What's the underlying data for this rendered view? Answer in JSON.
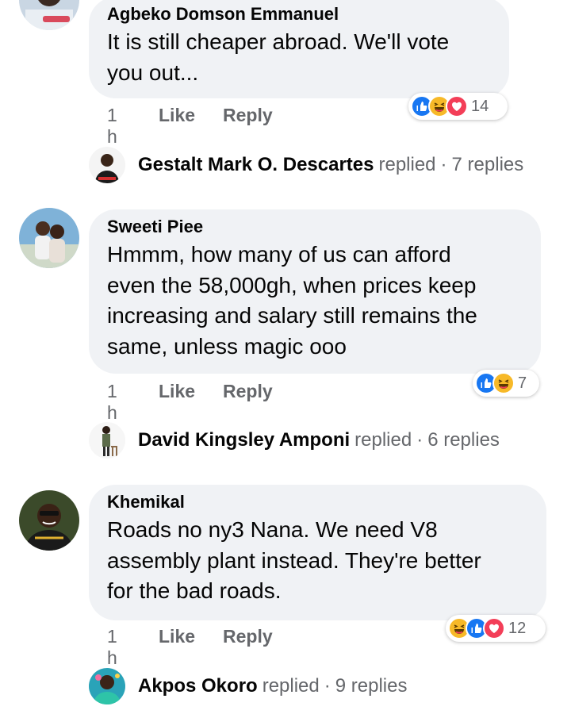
{
  "comments": [
    {
      "author": "Agbeko Domson Emmanuel",
      "text": "It is still cheaper abroad. We'll vote\nyou out...",
      "time": "1 h",
      "like_label": "Like",
      "reply_label": "Reply",
      "reactions": [
        "like",
        "haha",
        "love"
      ],
      "reaction_count": "14",
      "replies": {
        "name": "Gestalt Mark O. Descartes",
        "verb": "replied",
        "count": "7 replies"
      }
    },
    {
      "author": "Sweeti Piee",
      "text": "Hmmm, how many of us can afford\neven the 58,000gh, when prices keep\nincreasing and salary still remains the\nsame, unless magic ooo",
      "time": "1 h",
      "like_label": "Like",
      "reply_label": "Reply",
      "reactions": [
        "like",
        "haha"
      ],
      "reaction_count": "7",
      "replies": {
        "name": "David Kingsley Amponi",
        "verb": "replied",
        "count": "6 replies"
      }
    },
    {
      "author": "Khemikal",
      "text": "Roads no ny3 Nana. We need V8\nassembly plant instead. They're better\nfor the bad roads.",
      "time": "1 h",
      "like_label": "Like",
      "reply_label": "Reply",
      "reactions": [
        "haha",
        "like",
        "love"
      ],
      "reaction_count": "12",
      "replies": {
        "name": "Akpos Okoro",
        "verb": "replied",
        "count": "9 replies"
      }
    }
  ],
  "colors": {
    "bubble": "#f0f2f5",
    "secondary_text": "#65676b",
    "like_blue": "#1877f2",
    "love_red": "#f33e58",
    "haha_yellow": "#f7b928"
  }
}
